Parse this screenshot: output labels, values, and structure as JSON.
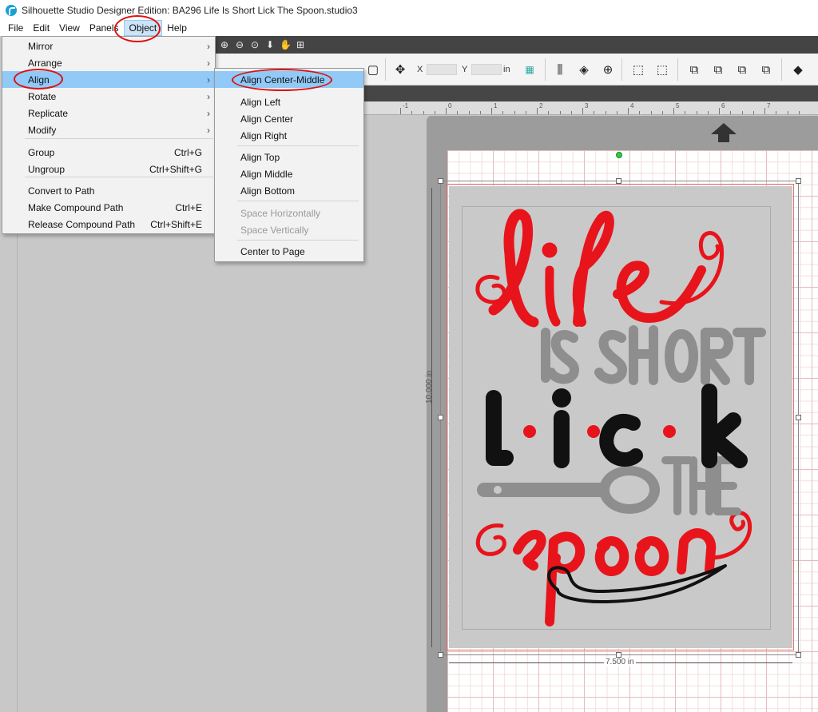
{
  "window": {
    "title": "Silhouette Studio Designer Edition: BA296 Life Is Short Lick The Spoon.studio3"
  },
  "menubar": {
    "items": [
      "File",
      "Edit",
      "View",
      "Panels",
      "Object",
      "Help"
    ],
    "active": "Object"
  },
  "object_menu": {
    "items": [
      {
        "label": "Mirror",
        "shortcut": "",
        "submenu": true
      },
      {
        "label": "Arrange",
        "shortcut": "",
        "submenu": true
      },
      {
        "label": "Align",
        "shortcut": "",
        "submenu": true,
        "highlighted": true
      },
      {
        "label": "Rotate",
        "shortcut": "",
        "submenu": true
      },
      {
        "label": "Replicate",
        "shortcut": "",
        "submenu": true
      },
      {
        "label": "Modify",
        "shortcut": "",
        "submenu": true
      },
      {
        "label": "Group",
        "shortcut": "Ctrl+G"
      },
      {
        "label": "Ungroup",
        "shortcut": "Ctrl+Shift+G"
      },
      {
        "label": "Convert to Path",
        "shortcut": ""
      },
      {
        "label": "Make Compound Path",
        "shortcut": "Ctrl+E"
      },
      {
        "label": "Release Compound Path",
        "shortcut": "Ctrl+Shift+E"
      }
    ]
  },
  "align_submenu": {
    "items": [
      {
        "label": "Align Center-Middle",
        "highlighted": true
      },
      {
        "label": "Align Left"
      },
      {
        "label": "Align Center"
      },
      {
        "label": "Align Right"
      },
      {
        "label": "Align Top"
      },
      {
        "label": "Align Middle"
      },
      {
        "label": "Align Bottom"
      },
      {
        "label": "Space Horizontally",
        "disabled": true
      },
      {
        "label": "Space Vertically",
        "disabled": true
      },
      {
        "label": "Center to Page"
      }
    ]
  },
  "toolbar": {
    "x_label": "X",
    "y_label": "Y",
    "unit": "in"
  },
  "ruler": {
    "labels": [
      "-1",
      "0",
      "1",
      "2",
      "3",
      "4",
      "5",
      "6",
      "7"
    ]
  },
  "dimensions": {
    "height": "10.000 in",
    "width": "7.500 in"
  },
  "artwork_colors": {
    "red": "#e8141b",
    "gray": "#8e8e8e",
    "black": "#111111"
  },
  "icons": [
    "zoom-in-icon",
    "zoom-out-icon",
    "zoom-select-icon",
    "move-down-icon",
    "pan-hand-icon",
    "fit-page-icon",
    "move-icon",
    "align-icon",
    "center-icon",
    "group-icon",
    "ungroup-icon",
    "fill-icon",
    "feed-arrow-icon"
  ]
}
